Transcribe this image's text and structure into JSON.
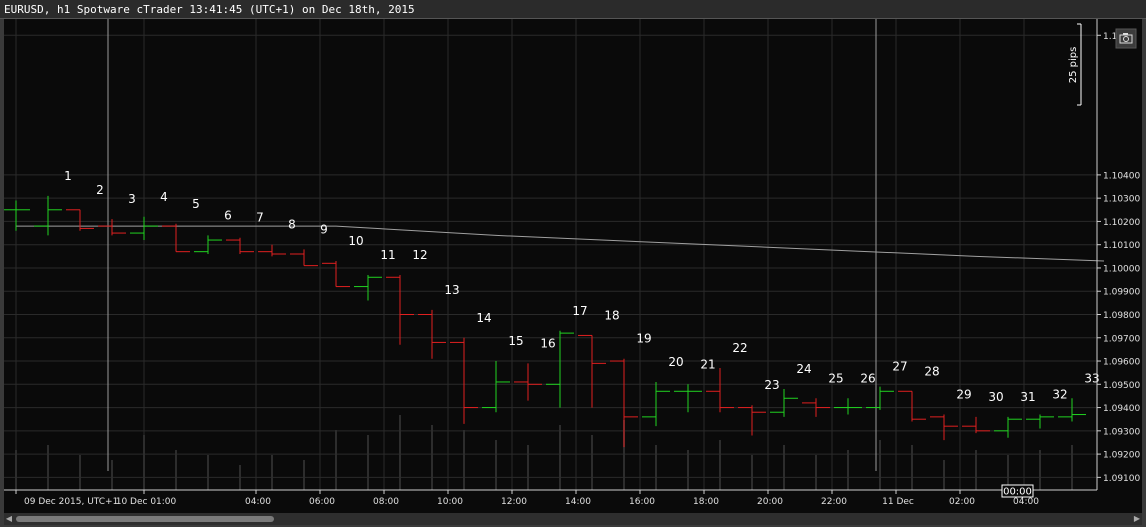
{
  "title_bar": {
    "text": "EURUSD, h1 Spotware cTrader 13:41:45 (UTC+1) on Dec 18th, 2015"
  },
  "pip_label": "25 pips",
  "cursor_time_label": "00:00",
  "colors": {
    "bull": "#21d421",
    "bear": "#e02020",
    "ma": "#a0a0a0",
    "grid": "#2a2a2a",
    "axis_text": "#e0e0e0"
  },
  "icons": {
    "camera": "camera-icon"
  },
  "chart_data": {
    "type": "ohlc",
    "symbol": "EURUSD",
    "timeframe": "h1",
    "ylim": [
      1.0905,
      1.1107
    ],
    "y_ticks": [
      "1.10",
      "1.10400",
      "1.10300",
      "1.10200",
      "1.10100",
      "1.10000",
      "1.09900",
      "1.09800",
      "1.09700",
      "1.09600",
      "1.09500",
      "1.09400",
      "1.09300",
      "1.09200",
      "1.09100"
    ],
    "y_tick_values": [
      1.11,
      1.104,
      1.103,
      1.102,
      1.101,
      1.1,
      1.099,
      1.098,
      1.097,
      1.096,
      1.095,
      1.094,
      1.093,
      1.092,
      1.091
    ],
    "x_labels": [
      "09 Dec 2015, UTC+1",
      "10 Dec 01:00",
      "04:00",
      "06:00",
      "08:00",
      "10:00",
      "12:00",
      "14:00",
      "16:00",
      "18:00",
      "20:00",
      "22:00",
      "11 Dec",
      "02:00",
      "04:00"
    ],
    "x_label_bar_index": [
      0,
      4,
      7.5,
      9.5,
      11.5,
      13.5,
      15.5,
      17.5,
      19.5,
      21.5,
      23.5,
      25.5,
      27.5,
      29.5,
      31.5
    ],
    "grid": true,
    "day_separators_bar_index": [
      3,
      27
    ],
    "bars": [
      {
        "label": "",
        "o": 1.1025,
        "h": 1.1029,
        "l": 1.1016,
        "c": 1.1025
      },
      {
        "label": "1",
        "o": 1.1018,
        "h": 1.1031,
        "l": 1.1014,
        "c": 1.1025
      },
      {
        "label": "2",
        "o": 1.1025,
        "h": 1.1025,
        "l": 1.1016,
        "c": 1.1017
      },
      {
        "label": "3",
        "o": 1.1018,
        "h": 1.1021,
        "l": 1.1014,
        "c": 1.1015
      },
      {
        "label": "4",
        "o": 1.1015,
        "h": 1.1022,
        "l": 1.1012,
        "c": 1.1018
      },
      {
        "label": "5",
        "o": 1.1018,
        "h": 1.1019,
        "l": 1.1007,
        "c": 1.1007
      },
      {
        "label": "6",
        "o": 1.1007,
        "h": 1.1014,
        "l": 1.1006,
        "c": 1.1012
      },
      {
        "label": "7",
        "o": 1.1012,
        "h": 1.1013,
        "l": 1.1006,
        "c": 1.1007
      },
      {
        "label": "8",
        "o": 1.1007,
        "h": 1.101,
        "l": 1.1005,
        "c": 1.1006
      },
      {
        "label": "9",
        "o": 1.1006,
        "h": 1.1008,
        "l": 1.1001,
        "c": 1.1001
      },
      {
        "label": "10",
        "o": 1.1002,
        "h": 1.1003,
        "l": 1.0992,
        "c": 1.0992
      },
      {
        "label": "11",
        "o": 1.0992,
        "h": 1.0997,
        "l": 1.0986,
        "c": 1.0996
      },
      {
        "label": "12",
        "o": 1.0996,
        "h": 1.0997,
        "l": 1.0967,
        "c": 1.098
      },
      {
        "label": "13",
        "o": 1.098,
        "h": 1.0982,
        "l": 1.0961,
        "c": 1.0968
      },
      {
        "label": "14",
        "o": 1.0968,
        "h": 1.097,
        "l": 1.0933,
        "c": 1.094
      },
      {
        "label": "15",
        "o": 1.094,
        "h": 1.096,
        "l": 1.0938,
        "c": 1.0951
      },
      {
        "label": "16",
        "o": 1.0951,
        "h": 1.0959,
        "l": 1.0943,
        "c": 1.095
      },
      {
        "label": "17",
        "o": 1.095,
        "h": 1.0973,
        "l": 1.094,
        "c": 1.0972
      },
      {
        "label": "18",
        "o": 1.0971,
        "h": 1.0971,
        "l": 1.094,
        "c": 1.0959
      },
      {
        "label": "19",
        "o": 1.096,
        "h": 1.0961,
        "l": 1.0923,
        "c": 1.0936
      },
      {
        "label": "20",
        "o": 1.0936,
        "h": 1.0951,
        "l": 1.0932,
        "c": 1.0947
      },
      {
        "label": "21",
        "o": 1.0947,
        "h": 1.095,
        "l": 1.0938,
        "c": 1.0947
      },
      {
        "label": "22",
        "o": 1.0947,
        "h": 1.0957,
        "l": 1.0938,
        "c": 1.094
      },
      {
        "label": "23",
        "o": 1.094,
        "h": 1.0941,
        "l": 1.0928,
        "c": 1.0938
      },
      {
        "label": "24",
        "o": 1.0938,
        "h": 1.0948,
        "l": 1.0936,
        "c": 1.0944
      },
      {
        "label": "25",
        "o": 1.0942,
        "h": 1.0944,
        "l": 1.0936,
        "c": 1.094
      },
      {
        "label": "26",
        "o": 1.094,
        "h": 1.0944,
        "l": 1.0937,
        "c": 1.094
      },
      {
        "label": "27",
        "o": 1.094,
        "h": 1.0949,
        "l": 1.0939,
        "c": 1.0947
      },
      {
        "label": "28",
        "o": 1.0947,
        "h": 1.0947,
        "l": 1.0934,
        "c": 1.0935
      },
      {
        "label": "29",
        "o": 1.0936,
        "h": 1.0937,
        "l": 1.0926,
        "c": 1.0932
      },
      {
        "label": "30",
        "o": 1.0932,
        "h": 1.0936,
        "l": 1.0929,
        "c": 1.093
      },
      {
        "label": "31",
        "o": 1.093,
        "h": 1.0936,
        "l": 1.0927,
        "c": 1.0935
      },
      {
        "label": "32",
        "o": 1.0935,
        "h": 1.0937,
        "l": 1.0931,
        "c": 1.0936
      },
      {
        "label": "33",
        "o": 1.0936,
        "h": 1.0944,
        "l": 1.0934,
        "c": 1.0937
      }
    ],
    "moving_average": {
      "x_bar_index": [
        0,
        10,
        15,
        20,
        25,
        30,
        34
      ],
      "values": [
        1.1018,
        1.1018,
        1.1014,
        1.1011,
        1.1008,
        1.1005,
        1.1003
      ]
    },
    "volume": [
      40,
      45,
      35,
      30,
      55,
      40,
      35,
      25,
      35,
      30,
      60,
      55,
      75,
      65,
      60,
      50,
      45,
      65,
      55,
      70,
      45,
      40,
      50,
      35,
      45,
      35,
      40,
      50,
      45,
      30,
      40,
      35,
      40,
      45
    ]
  }
}
